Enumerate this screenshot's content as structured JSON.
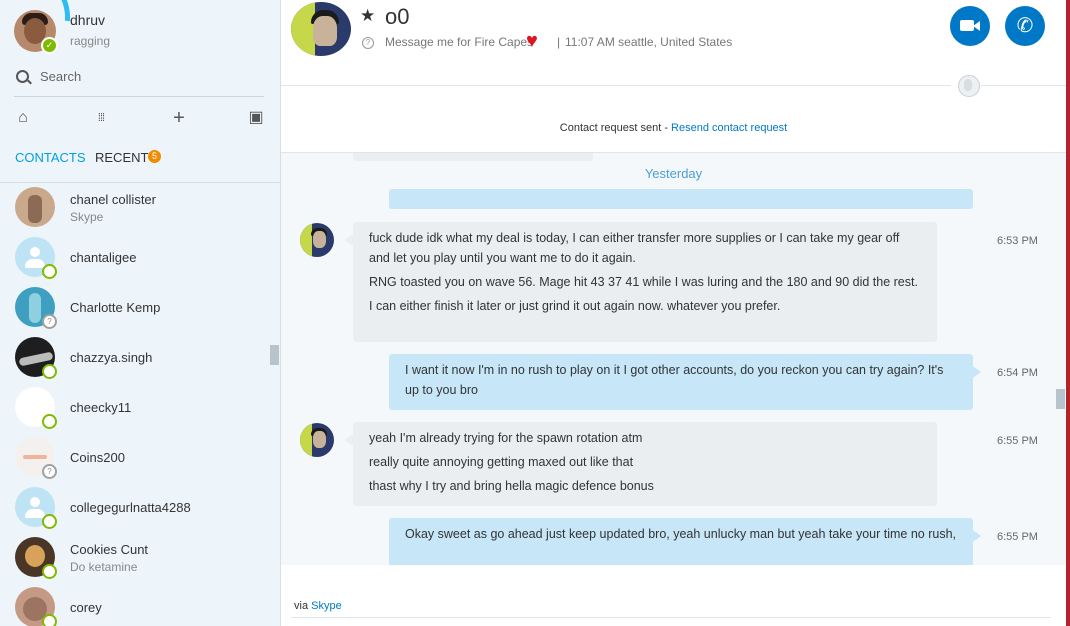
{
  "me": {
    "name": "dhruv",
    "status": "ragging"
  },
  "search": {
    "label": "Search"
  },
  "tabs": {
    "contacts": "CONTACTS",
    "recent": "RECENT",
    "recent_count": "5"
  },
  "contacts": [
    {
      "name": "chanel collister",
      "sub": "Skype"
    },
    {
      "name": "chantaligee",
      "sub": ""
    },
    {
      "name": "Charlotte Kemp",
      "sub": ""
    },
    {
      "name": "chazzya.singh",
      "sub": ""
    },
    {
      "name": "cheecky11",
      "sub": ""
    },
    {
      "name": "Coins200",
      "sub": ""
    },
    {
      "name": "collegegurlnatta4288",
      "sub": ""
    },
    {
      "name": "Cookies Cunt",
      "sub": "Do ketamine"
    },
    {
      "name": "corey",
      "sub": ""
    }
  ],
  "conversation": {
    "name": "o0",
    "mood": "Message me for Fire Capes",
    "separator": "|",
    "local_time": "11:07 AM seattle, United States",
    "contact_request": "Contact request sent - ",
    "resend_link": "Resend contact request",
    "date_separator": "Yesterday",
    "messages": [
      {
        "dir": "in",
        "time": "6:53 PM",
        "lines": [
          "fuck dude idk what my deal is today, I can either transfer more supplies or I can take my gear off and let you play until you want me to do it again.",
          "RNG toasted you on wave 56. Mage hit 43 37 41 while I was luring and the 180 and 90 did the rest.",
          "I can either finish it later or just grind it out again now. whatever you prefer."
        ]
      },
      {
        "dir": "out",
        "time": "6:54 PM",
        "lines": [
          "I want it now I'm in no rush to play on it I got other accounts, do you reckon you can try again? It's up to you bro"
        ]
      },
      {
        "dir": "in",
        "time": "6:55 PM",
        "lines": [
          "yeah I'm already trying for the spawn rotation atm",
          "really quite annoying getting maxed out like that",
          "thast why I try and bring hella magic defence bonus"
        ]
      },
      {
        "dir": "out",
        "time": "6:55 PM",
        "lines": [
          "Okay sweet as go ahead just keep updated bro, yeah unlucky man but yeah take your time no rush,"
        ]
      }
    ],
    "via_prefix": "via ",
    "via_link": "Skype"
  },
  "colors": {
    "accent": "#00a0e0",
    "call_button": "#0078c8",
    "online": "#7fba00",
    "badge": "#f08c00",
    "outgoing_bubble": "#c7e7f8",
    "incoming_bubble": "#eaeef1"
  }
}
